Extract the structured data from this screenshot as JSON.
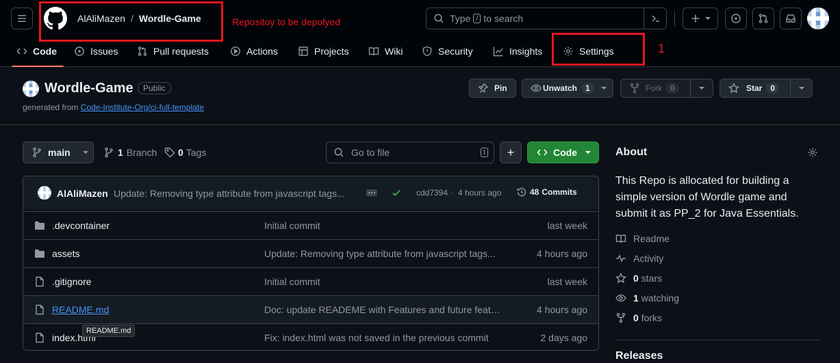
{
  "header": {
    "owner": "AlAliMazen",
    "separator": "/",
    "repo": "Wordle-Game",
    "annotation_repo": "Repositoy to be depolyed",
    "search_prefix": "Type",
    "search_key": "/",
    "search_suffix": "to search",
    "annotation_settings": "1"
  },
  "tabs": [
    {
      "label": "Code"
    },
    {
      "label": "Issues"
    },
    {
      "label": "Pull requests"
    },
    {
      "label": "Actions"
    },
    {
      "label": "Projects"
    },
    {
      "label": "Wiki"
    },
    {
      "label": "Security"
    },
    {
      "label": "Insights"
    },
    {
      "label": "Settings"
    }
  ],
  "repo_head": {
    "name": "Wordle-Game",
    "visibility": "Public",
    "generated_prefix": "generated from",
    "template_link": "Code-Institute-Org/ci-full-template",
    "pin": "Pin",
    "unwatch": "Unwatch",
    "watch_count": "1",
    "fork": "Fork",
    "fork_count": "0",
    "star": "Star",
    "star_count": "0"
  },
  "toolbar": {
    "branch": "main",
    "branch_count": "1",
    "branch_label": "Branch",
    "tag_count": "0",
    "tag_label": "Tags",
    "go_to_file": "Go to file",
    "go_to_file_key": "t",
    "add": "+",
    "code": "Code"
  },
  "latest_commit": {
    "author": "AlAliMazen",
    "message": "Update: Removing type attribute from javascript tags...",
    "hash": "cdd7394",
    "time": "4 hours ago",
    "commits_count": "48",
    "commits_label": "Commits"
  },
  "files": [
    {
      "name": ".devcontainer",
      "type": "folder",
      "message": "Initial commit",
      "time": "last week"
    },
    {
      "name": "assets",
      "type": "folder",
      "message": "Update: Removing type attribute from javascript tags...",
      "time": "4 hours ago"
    },
    {
      "name": ".gitignore",
      "type": "file",
      "message": "Initial commit",
      "time": "last week"
    },
    {
      "name": "README.md",
      "type": "file",
      "message": "Doc: update READEME with Features and future features...",
      "time": "4 hours ago"
    },
    {
      "name": "index.html",
      "type": "file",
      "message": "Fix: index.html was not saved in the previous commit",
      "time": "2 days ago"
    }
  ],
  "tooltip": "README.md",
  "about": {
    "title": "About",
    "description": "This Repo is allocated for building a simple version of Wordle game and submit it as PP_2 for Java Essentials.",
    "readme": "Readme",
    "activity": "Activity",
    "stars_count": "0",
    "stars_label": "stars",
    "watching_count": "1",
    "watching_label": "watching",
    "forks_count": "0",
    "forks_label": "forks",
    "releases": "Releases"
  },
  "colors": {
    "accent": "#238636",
    "annotation": "#e5161d",
    "link": "#4493f8"
  }
}
